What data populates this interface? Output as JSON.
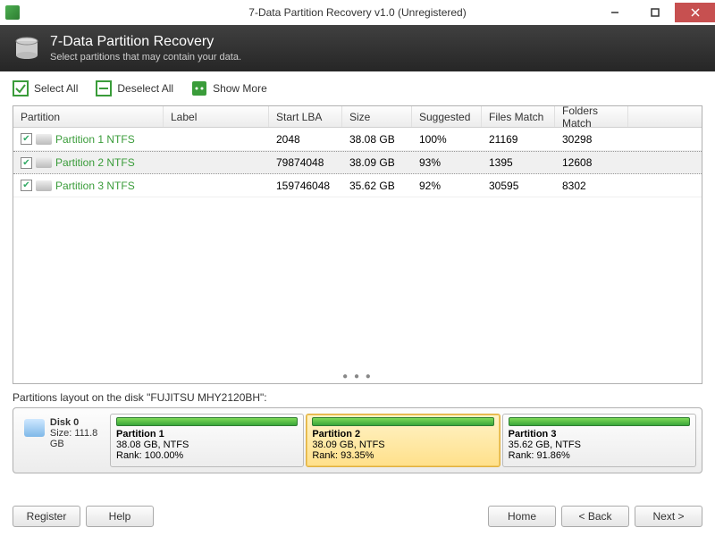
{
  "window": {
    "title": "7-Data Partition Recovery v1.0 (Unregistered)"
  },
  "header": {
    "title": "7-Data Partition Recovery",
    "subtitle": "Select partitions that may contain your data."
  },
  "toolbar": {
    "select_all": "Select All",
    "deselect_all": "Deselect All",
    "show_more": "Show More"
  },
  "columns": {
    "partition": "Partition",
    "label": "Label",
    "start_lba": "Start LBA",
    "size": "Size",
    "suggested": "Suggested",
    "files_match": "Files Match",
    "folders_match": "Folders Match"
  },
  "partitions": [
    {
      "name": "Partition 1 NTFS",
      "label": "",
      "start_lba": "2048",
      "size": "38.08 GB",
      "suggested": "100%",
      "files_match": "21169",
      "folders_match": "30298",
      "checked": true
    },
    {
      "name": "Partition 2 NTFS",
      "label": "",
      "start_lba": "79874048",
      "size": "38.09 GB",
      "suggested": "93%",
      "files_match": "1395",
      "folders_match": "12608",
      "checked": true,
      "selected": true
    },
    {
      "name": "Partition 3 NTFS",
      "label": "",
      "start_lba": "159746048",
      "size": "35.62 GB",
      "suggested": "92%",
      "files_match": "30595",
      "folders_match": "8302",
      "checked": true
    }
  ],
  "layout": {
    "label": "Partitions layout on the disk \"FUJITSU MHY2120BH\":",
    "disk": {
      "name": "Disk 0",
      "size": "Size: 111.8 GB"
    },
    "blocks": [
      {
        "title": "Partition 1",
        "line1": "38.08 GB, NTFS",
        "line2": "Rank: 100.00%"
      },
      {
        "title": "Partition 2",
        "line1": "38.09 GB, NTFS",
        "line2": "Rank: 93.35%",
        "active": true
      },
      {
        "title": "Partition 3",
        "line1": "35.62 GB, NTFS",
        "line2": "Rank: 91.86%"
      }
    ]
  },
  "footer": {
    "register": "Register",
    "help": "Help",
    "home": "Home",
    "back": "< Back",
    "next": "Next >"
  }
}
